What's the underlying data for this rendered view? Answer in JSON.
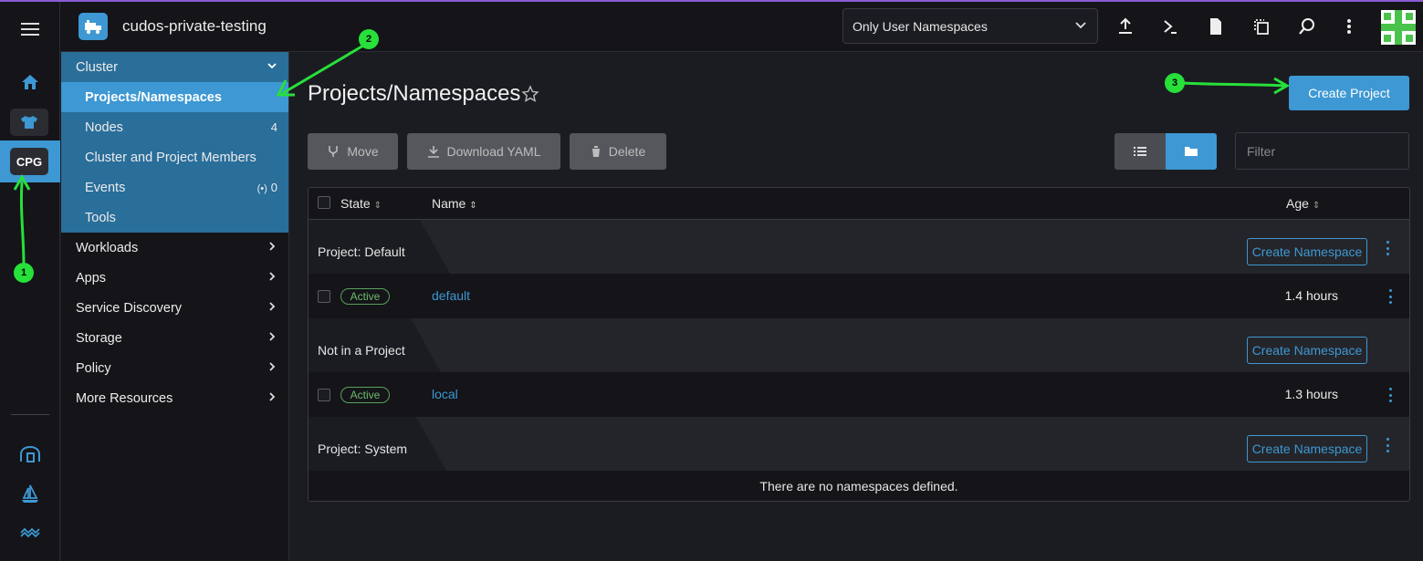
{
  "header": {
    "cluster_name": "cudos-private-testing",
    "namespace_filter": "Only User Namespaces"
  },
  "rail": {
    "cluster_badge": "CPG"
  },
  "sidebar": {
    "group_label": "Cluster",
    "items": [
      {
        "label": "Projects/Namespaces",
        "count": ""
      },
      {
        "label": "Nodes",
        "count": "4"
      },
      {
        "label": "Cluster and Project Members",
        "count": ""
      },
      {
        "label": "Events",
        "count": "0"
      },
      {
        "label": "Tools",
        "count": ""
      }
    ],
    "sections": [
      "Workloads",
      "Apps",
      "Service Discovery",
      "Storage",
      "Policy",
      "More Resources"
    ]
  },
  "main": {
    "title": "Projects/Namespaces",
    "create_project": "Create Project",
    "actions": {
      "move": "Move",
      "download": "Download YAML",
      "delete": "Delete"
    },
    "filter_placeholder": "Filter",
    "columns": {
      "state": "State",
      "name": "Name",
      "age": "Age"
    },
    "create_namespace": "Create Namespace",
    "groups": [
      {
        "label": "Project:  Default"
      },
      {
        "label": "Not in a Project"
      },
      {
        "label": "Project:  System"
      }
    ],
    "rows": [
      {
        "state": "Active",
        "name": "default",
        "age": "1.4 hours"
      },
      {
        "state": "Active",
        "name": "local",
        "age": "1.3 hours"
      }
    ],
    "empty_message": "There are no namespaces defined."
  },
  "annotations": [
    "1",
    "2",
    "3"
  ],
  "colors": {
    "accent": "#3d98d3",
    "marker": "#27e03a",
    "active_badge": "#6dbb6d"
  }
}
